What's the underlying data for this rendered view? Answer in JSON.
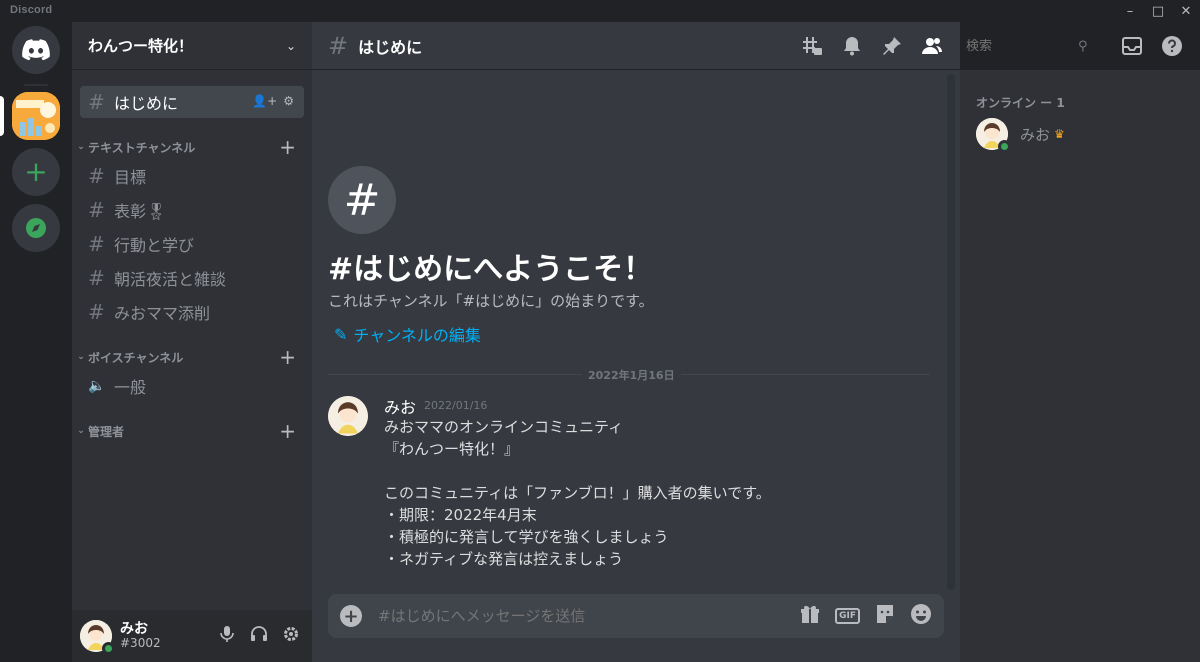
{
  "app": {
    "brand": "Discord"
  },
  "guild": {
    "name": "わんつー特化！"
  },
  "sidebar": {
    "active_channel": {
      "name": "はじめに"
    },
    "categories": [
      {
        "label": "テキストチャンネル",
        "channels": [
          "目標",
          "表彰🎖",
          "行動と学び",
          "朝活夜活と雑談",
          "みおママ添削"
        ]
      },
      {
        "label": "ボイスチャンネル",
        "channels": [
          "一般"
        ]
      },
      {
        "label": "管理者",
        "channels": []
      }
    ]
  },
  "user": {
    "name": "みお",
    "tag": "#3002"
  },
  "channel": {
    "name": "はじめに"
  },
  "welcome": {
    "title": "#はじめにへようこそ！",
    "subtitle": "これはチャンネル「#はじめに」の始まりです。",
    "edit_label": "チャンネルの編集"
  },
  "divider": {
    "date": "2022年1月16日"
  },
  "message": {
    "author": "みお",
    "timestamp": "2022/01/16",
    "lines": [
      "みおママのオンラインコミュニティ",
      "『わんつー特化！』",
      "",
      "このコミュニティは「ファンブロ！」購入者の集いです。",
      "・期限：2022年4月末",
      "・積極的に発言して学びを強くしましょう",
      "・ネガティブな発言は控えましょう"
    ]
  },
  "composer": {
    "placeholder": "#はじめにへメッセージを送信",
    "gif_label": "GIF"
  },
  "search": {
    "placeholder": "検索"
  },
  "members": {
    "heading": "オンライン ー 1",
    "list": [
      {
        "name": "みお",
        "owner": true
      }
    ]
  },
  "colors": {
    "online": "#3ba55c",
    "link": "#00aff4",
    "crown": "#faa81a",
    "server_icon_bg": "#f7a93c"
  }
}
